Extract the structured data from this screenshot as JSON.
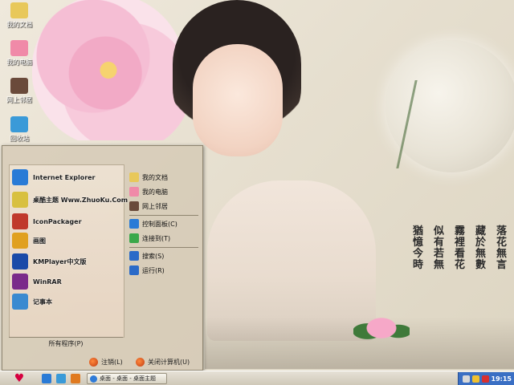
{
  "desktop": {
    "icons": [
      {
        "label": "我的文档",
        "icon": "my-documents-icon",
        "color": "#e8c85a"
      },
      {
        "label": "我的电脑",
        "icon": "my-computer-icon",
        "color": "#f08aa8"
      },
      {
        "label": "网上邻居",
        "icon": "network-places-icon",
        "color": "#6a4a3a"
      },
      {
        "label": "回收站",
        "icon": "recycle-bin-icon",
        "color": "#3a9ad8"
      }
    ],
    "calligraphy": [
      "落花無言",
      "藏於無數",
      "霧裡看花",
      "似有若無",
      "猶憶今時"
    ]
  },
  "start_menu": {
    "programs": [
      {
        "label": "Internet Explorer",
        "icon": "internet-explorer-icon",
        "color": "#2a7bd6"
      },
      {
        "label": "桌酷主题 Www.ZhuoKu.Com",
        "icon": "zhuoku-theme-icon",
        "color": "#d8c040"
      },
      {
        "label": "IconPackager",
        "icon": "iconpackager-icon",
        "color": "#c0392b"
      },
      {
        "label": "画图",
        "icon": "paint-icon",
        "color": "#e0a020"
      },
      {
        "label": "KMPlayer中文版",
        "icon": "kmplayer-icon",
        "color": "#1a4aa8"
      },
      {
        "label": "WinRAR",
        "icon": "winrar-icon",
        "color": "#7a2a8a"
      },
      {
        "label": "记事本",
        "icon": "notepad-icon",
        "color": "#3a8ad0"
      }
    ],
    "all_programs": "所有程序(P)",
    "places_top": [
      {
        "label": "我的文档",
        "icon": "my-documents-icon",
        "color": "#e8c85a"
      },
      {
        "label": "我的电脑",
        "icon": "my-computer-icon",
        "color": "#f08aa8"
      },
      {
        "label": "网上邻居",
        "icon": "network-places-icon",
        "color": "#6a4a3a"
      }
    ],
    "places_mid": [
      {
        "label": "控制面板(C)",
        "icon": "control-panel-icon",
        "color": "#2a7bd6"
      },
      {
        "label": "连接到(T)",
        "icon": "connect-to-icon",
        "color": "#3aa84a"
      }
    ],
    "places_bottom": [
      {
        "label": "搜索(S)",
        "icon": "search-icon",
        "color": "#2a6ac8"
      },
      {
        "label": "运行(R)",
        "icon": "run-icon",
        "color": "#2a6ac8"
      }
    ],
    "logoff": "注销(L)",
    "shutdown": "关闭计算机(U)"
  },
  "taskbar": {
    "start_symbol": "♥",
    "quick_launch": [
      {
        "icon": "show-desktop-icon",
        "color": "#2a7bd6"
      },
      {
        "icon": "ie-quicklaunch-icon",
        "color": "#3a9ad8"
      },
      {
        "icon": "media-player-icon",
        "color": "#e07a20"
      }
    ],
    "task_label": "桌面 - 桌面 - 桌面主题",
    "tray_icons": [
      {
        "icon": "volume-icon",
        "color": "#d8d8d8"
      },
      {
        "icon": "network-tray-icon",
        "color": "#f0c030"
      },
      {
        "icon": "security-tray-icon",
        "color": "#d83030"
      }
    ],
    "clock": "19:15"
  }
}
